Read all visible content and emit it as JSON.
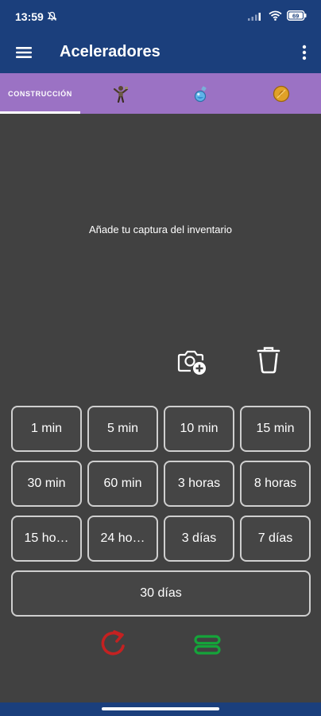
{
  "status": {
    "time": "13:59",
    "battery": "69"
  },
  "app": {
    "title": "Aceleradores"
  },
  "tabs": [
    {
      "label": "CONSTRUCCIÓN",
      "selected": true
    },
    {
      "icon": "builder-figure-icon"
    },
    {
      "icon": "potion-flask-icon"
    },
    {
      "icon": "gold-coin-icon"
    }
  ],
  "main": {
    "hint": "Añade tu captura del inventario"
  },
  "buttons": [
    "1 min",
    "5 min",
    "10 min",
    "15 min",
    "30 min",
    "60 min",
    "3 horas",
    "8 horas",
    "15 ho…",
    "24 ho…",
    "3 días",
    "7 días",
    "30 días"
  ],
  "colors": {
    "primary": "#1b3f7c",
    "tab_bar": "#9b72c4",
    "background": "#414141",
    "reset_icon": "#c42121",
    "stack_icon": "#15a43a"
  }
}
